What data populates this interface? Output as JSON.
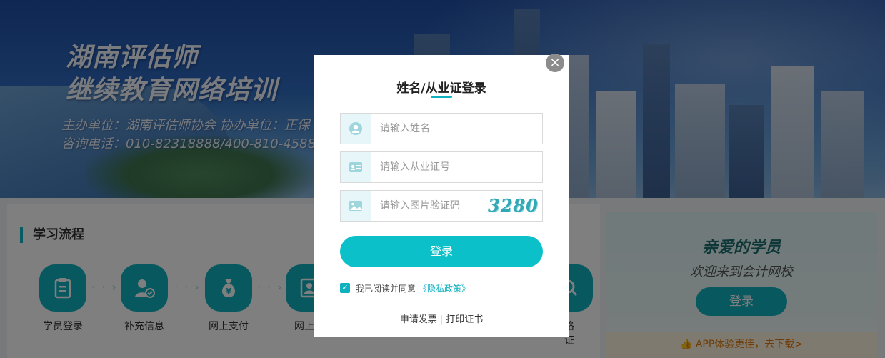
{
  "banner": {
    "title_line1": "湖南评估师",
    "title_line2": "继续教育网络培训",
    "organizers": "主办单位：湖南评估师协会    协办单位：正保",
    "phone": "咨询电话：010-82318888/400-810-4588"
  },
  "process": {
    "title": "学习流程",
    "steps": [
      {
        "label": "学员登录",
        "icon": "clipboard-icon"
      },
      {
        "label": "补充信息",
        "icon": "user-check-icon"
      },
      {
        "label": "网上支付",
        "icon": "money-bag-icon"
      },
      {
        "label": "网上学",
        "icon": "id-card-icon"
      }
    ],
    "partial_last_label": "格",
    "partial_last_label2": "证"
  },
  "welcome_card": {
    "title": "亲爱的学员",
    "subtitle": "欢迎来到会计网校",
    "login_label": "登录",
    "app_promo": "APP体验更佳，去下载>"
  },
  "modal": {
    "close_glyph": "×",
    "title": "姓名/从业证登录",
    "name_placeholder": "请输入姓名",
    "cert_placeholder": "请输入从业证号",
    "captcha_placeholder": "请输入图片验证码",
    "captcha_text": "3280",
    "login_label": "登录",
    "agree_text": "我已阅读并同意",
    "policy_link": "《隐私政策》",
    "invoice_link": "申请发票",
    "separator": "|",
    "print_link": "打印证书"
  },
  "colors": {
    "accent": "#0fb1bf",
    "login_button": "#0cc0c9",
    "overlay": "rgba(0,0,0,0.5)"
  }
}
